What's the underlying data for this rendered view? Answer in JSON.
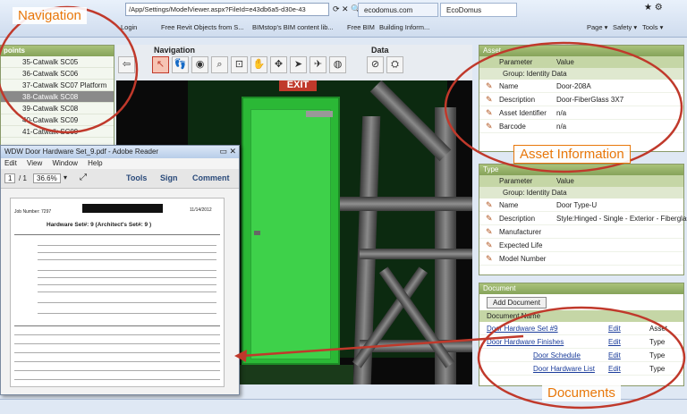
{
  "browser": {
    "address": "/App/Settings/ModelViewer.aspx?FileId=e43db6a5-d30e-43",
    "tabs": [
      "ecodomus.com",
      "EcoDomus"
    ],
    "favorites": [
      "Login",
      "Free Revit Objects from S...",
      "BIMstop's BIM content lib...",
      "Free BIM",
      "Building Inform..."
    ],
    "tools": [
      "Page ▾",
      "Safety ▾",
      "Tools ▾"
    ]
  },
  "points": {
    "title": "points",
    "items": [
      "35-Catwalk SC05",
      "36-Catwalk SC06",
      "37-Catwalk SC07 Platform",
      "38-Catwalk SC08",
      "39-Catwalk SC08",
      "40-Catwalk SC09",
      "41-Catwalk SC09"
    ],
    "selected_index": 3
  },
  "toolbar": {
    "navigation_title": "Navigation",
    "data_title": "Data"
  },
  "viewport": {
    "exit_sign": "EXIT"
  },
  "pdf": {
    "title": "WDW Door Hardware Set_9.pdf - Adobe Reader",
    "menu": [
      "Edit",
      "View",
      "Window",
      "Help"
    ],
    "page_current": "1",
    "page_total": "/ 1",
    "zoom": "36.6%",
    "tools_label": "Tools",
    "sign_label": "Sign",
    "comment_label": "Comment",
    "doc": {
      "job": "Job Number: 7297",
      "date": "11/14/2012",
      "heading": "Hardware Set#: 9   (Architect's Set#: 9 )"
    }
  },
  "asset": {
    "title": "Asset",
    "col_param": "Parameter",
    "col_value": "Value",
    "group": "Group: Identity Data",
    "rows": [
      {
        "k": "Name",
        "v": "Door-208A"
      },
      {
        "k": "Description",
        "v": "Door-FiberGlass 3X7"
      },
      {
        "k": "Asset Identifier",
        "v": "n/a"
      },
      {
        "k": "Barcode",
        "v": "n/a"
      }
    ]
  },
  "type": {
    "title": "Type",
    "col_param": "Parameter",
    "col_value": "Value",
    "group": "Group: Identity Data",
    "rows": [
      {
        "k": "Name",
        "v": "Door Type-U"
      },
      {
        "k": "Description",
        "v": "Style:Hinged - Single - Exterior - Fiberglass"
      },
      {
        "k": "Manufacturer",
        "v": ""
      },
      {
        "k": "Expected Life",
        "v": ""
      },
      {
        "k": "Model Number",
        "v": ""
      }
    ]
  },
  "document": {
    "title": "Document",
    "add_label": "Add Document",
    "col_name": "Document Name",
    "rows": [
      {
        "name": "Door Hardware Set #9",
        "edit": "Edit",
        "type": "Asset"
      },
      {
        "name": "Door Hardware Finishes",
        "edit": "Edit",
        "type": "Type"
      },
      {
        "name": "Door Schedule",
        "edit": "Edit",
        "type": "Type"
      },
      {
        "name": "Door Hardware List",
        "edit": "Edit",
        "type": "Type"
      }
    ]
  },
  "annotations": {
    "navigation": "Navigation",
    "asset_info": "Asset Information",
    "documents": "Documents"
  },
  "colors": {
    "accent": "#e8770a",
    "panel_header": "#94ad68",
    "door": "#3ed14a"
  }
}
